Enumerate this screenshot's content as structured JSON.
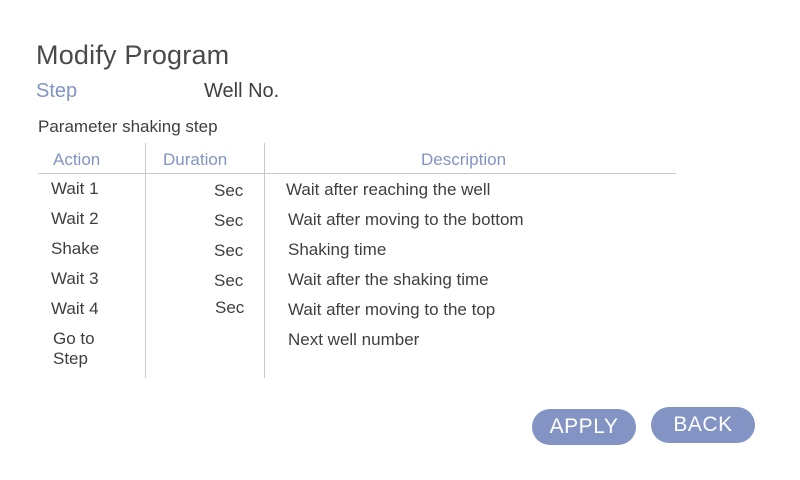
{
  "header": {
    "title": "Modify Program",
    "step_label": "Step",
    "well_label": "Well No."
  },
  "section": {
    "label": "Parameter shaking step"
  },
  "table": {
    "columns": {
      "action": "Action",
      "duration": "Duration",
      "description": "Description"
    },
    "rows": [
      {
        "action": "Wait 1",
        "unit": "Sec",
        "description": "Wait after reaching the well"
      },
      {
        "action": "Wait 2",
        "unit": "Sec",
        "description": "Wait after moving to the bottom"
      },
      {
        "action": "Shake",
        "unit": "Sec",
        "description": "Shaking time"
      },
      {
        "action": "Wait 3",
        "unit": "Sec",
        "description": "Wait after the shaking time"
      },
      {
        "action": "Wait 4",
        "unit": "Sec",
        "description": "Wait after moving to the top"
      },
      {
        "action_line1": "Go to",
        "action_line2": "Step",
        "unit": "",
        "description": "Next well number"
      }
    ]
  },
  "buttons": {
    "apply": "APPLY",
    "back": "BACK"
  },
  "colors": {
    "accent": "#8394c4",
    "text": "#3f3f3f",
    "divider": "#c9c9c9"
  }
}
